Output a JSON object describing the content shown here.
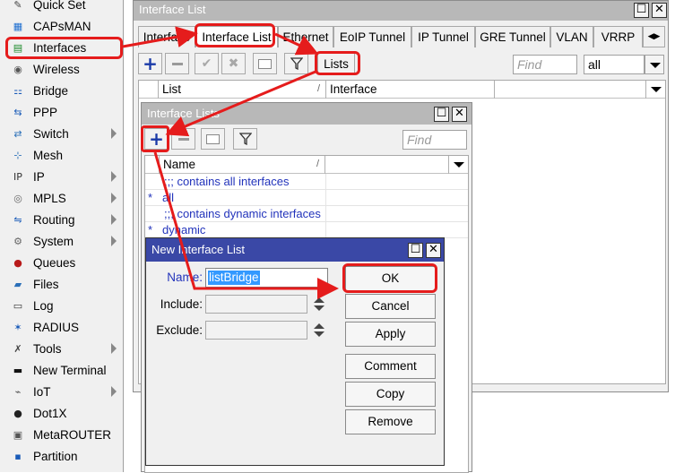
{
  "sidebar": {
    "items": [
      {
        "label": "Quick Set",
        "icon": "quick-set-icon",
        "arrow": false
      },
      {
        "label": "CAPsMAN",
        "icon": "capsman-icon",
        "arrow": false
      },
      {
        "label": "Interfaces",
        "icon": "interfaces-icon",
        "arrow": false
      },
      {
        "label": "Wireless",
        "icon": "wireless-icon",
        "arrow": false
      },
      {
        "label": "Bridge",
        "icon": "bridge-icon",
        "arrow": false
      },
      {
        "label": "PPP",
        "icon": "ppp-icon",
        "arrow": false
      },
      {
        "label": "Switch",
        "icon": "switch-icon",
        "arrow": true
      },
      {
        "label": "Mesh",
        "icon": "mesh-icon",
        "arrow": false
      },
      {
        "label": "IP",
        "icon": "ip-icon",
        "arrow": true
      },
      {
        "label": "MPLS",
        "icon": "mpls-icon",
        "arrow": true
      },
      {
        "label": "Routing",
        "icon": "routing-icon",
        "arrow": true
      },
      {
        "label": "System",
        "icon": "system-icon",
        "arrow": true
      },
      {
        "label": "Queues",
        "icon": "queues-icon",
        "arrow": false
      },
      {
        "label": "Files",
        "icon": "files-icon",
        "arrow": false
      },
      {
        "label": "Log",
        "icon": "log-icon",
        "arrow": false
      },
      {
        "label": "RADIUS",
        "icon": "radius-icon",
        "arrow": false
      },
      {
        "label": "Tools",
        "icon": "tools-icon",
        "arrow": true
      },
      {
        "label": "New Terminal",
        "icon": "terminal-icon",
        "arrow": false
      },
      {
        "label": "IoT",
        "icon": "iot-icon",
        "arrow": true
      },
      {
        "label": "Dot1X",
        "icon": "dot1x-icon",
        "arrow": false
      },
      {
        "label": "MetaROUTER",
        "icon": "metarouter-icon",
        "arrow": false
      },
      {
        "label": "Partition",
        "icon": "partition-icon",
        "arrow": false
      }
    ]
  },
  "interface_window": {
    "title": "Interface List",
    "tabs": [
      "Interface",
      "Interface List",
      "Ethernet",
      "EoIP Tunnel",
      "IP Tunnel",
      "GRE Tunnel",
      "VLAN",
      "VRRP"
    ],
    "lists_button": "Lists",
    "find_placeholder": "Find",
    "filter_value": "all",
    "columns": [
      "List",
      "Interface"
    ]
  },
  "lists_window": {
    "title": "Interface Lists",
    "find_placeholder": "Find",
    "column": "Name",
    "rows": [
      {
        "marker": "",
        "text": ";;; contains all interfaces",
        "type": "comment"
      },
      {
        "marker": "*",
        "text": "all",
        "type": "entry"
      },
      {
        "marker": "",
        "text": ";;; contains dynamic interfaces",
        "type": "comment"
      },
      {
        "marker": "*",
        "text": "dynamic",
        "type": "entry"
      }
    ]
  },
  "new_dialog": {
    "title": "New Interface List",
    "name_label": "Name:",
    "name_value": "listBridge",
    "include_label": "Include:",
    "exclude_label": "Exclude:",
    "buttons": [
      "OK",
      "Cancel",
      "Apply",
      "Comment",
      "Copy",
      "Remove"
    ]
  },
  "colors": {
    "highlight": "#e51c1c",
    "dialog_title": "#3a48a6",
    "selection": "#3399ff",
    "link_text": "#2233bb"
  }
}
